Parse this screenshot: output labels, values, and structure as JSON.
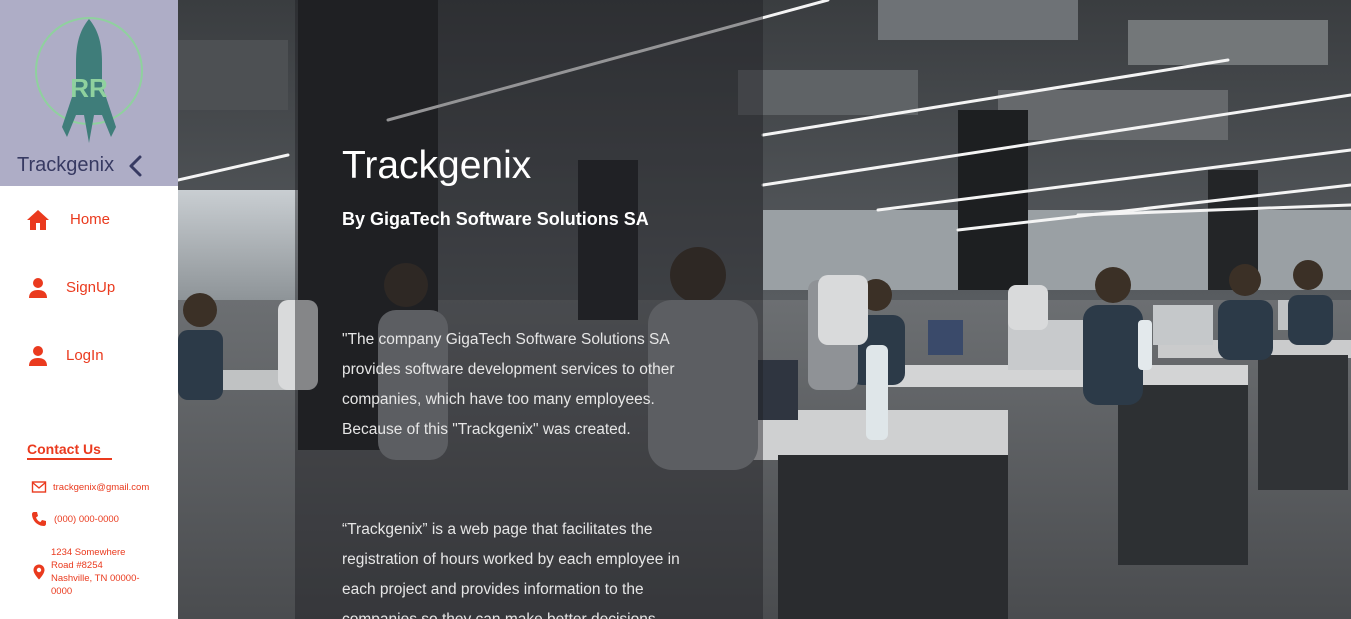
{
  "sidebar": {
    "brand_name": "Trackgenix",
    "logo_icon": "rocket-logo-icon",
    "collapse_icon": "chevron-left-icon",
    "nav": [
      {
        "label": "Home",
        "icon": "home-icon"
      },
      {
        "label": "SignUp",
        "icon": "user-icon"
      },
      {
        "label": "LogIn",
        "icon": "user-icon"
      }
    ],
    "contact": {
      "title": "Contact Us",
      "email": "trackgenix@gmail.com",
      "phone": "(000) 000-0000",
      "address_lines": [
        "1234 Somewhere",
        "Road #8254",
        "Nashville, TN 00000-",
        "0000"
      ]
    }
  },
  "hero": {
    "title": "Trackgenix",
    "subtitle": "By GigaTech Software Solutions SA",
    "paragraph_1": "\"The company GigaTech Software Solutions SA provides software development services to other companies, which have too many employees. Because of this \"Trackgenix\" was created.",
    "paragraph_2": "“Trackgenix” is a web page that facilitates the registration of hours worked by each employee in each project and provides information to the companies so they can make better decisions."
  },
  "colors": {
    "accent": "#ea3a1e",
    "brand_bg": "#aeadc6",
    "brand_text": "#373a62",
    "logo_teal": "#3f7d7a",
    "logo_green": "#8fd19e"
  }
}
